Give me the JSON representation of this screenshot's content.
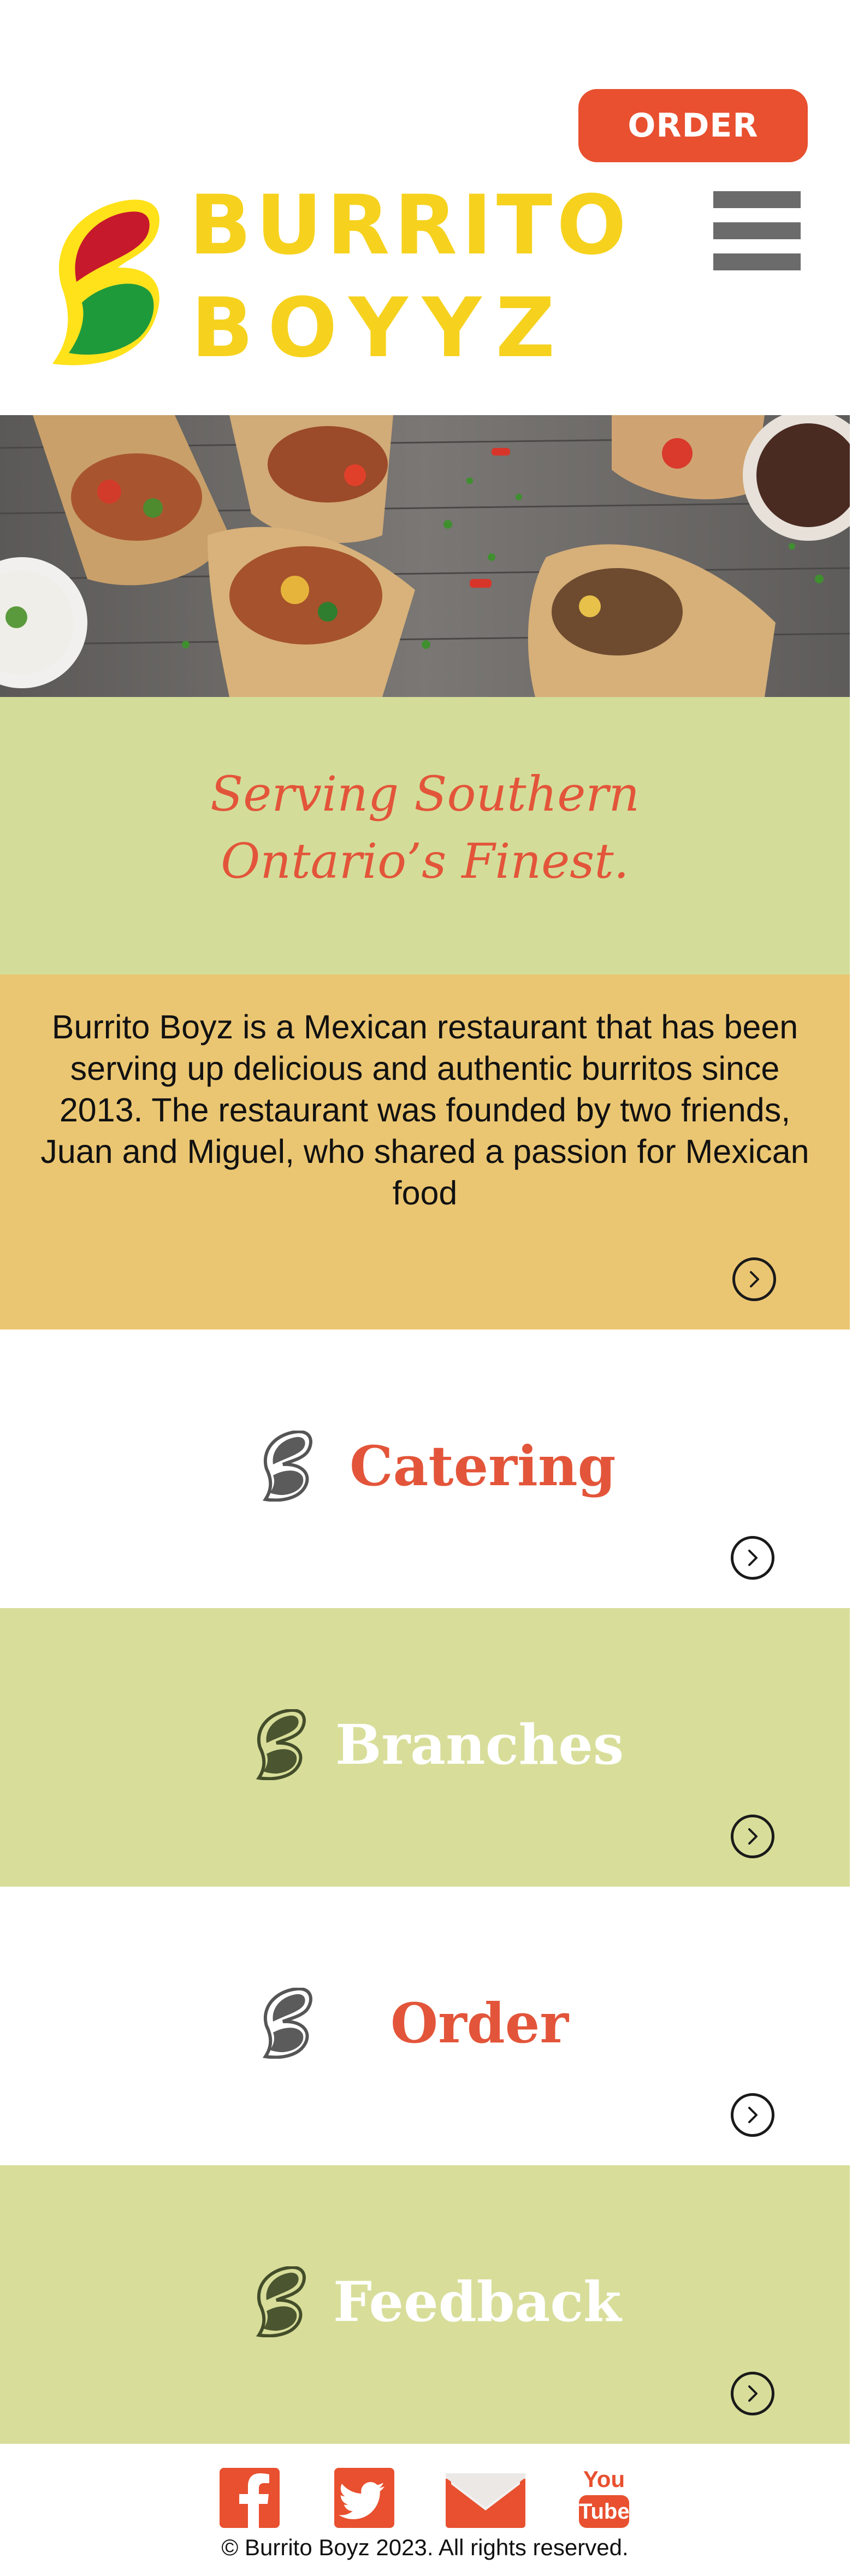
{
  "header": {
    "order_label": "ORDER",
    "brand_line1": "BURRITO",
    "brand_line2": "BOYYZ",
    "menu_icon": "hamburger-menu-icon"
  },
  "hero": {
    "image": "burritos-photo"
  },
  "tagline": {
    "text": "Serving Southern\nOntario’s Finest."
  },
  "about": {
    "text": "Burrito Boyz is a Mexican restaurant that has been serving up delicious and authentic burritos since 2013. The restaurant was founded by two friends, Juan and Miguel, who shared a passion for Mexican food"
  },
  "sections": [
    {
      "label": "Catering",
      "theme": "white",
      "label_color": "#e3553a"
    },
    {
      "label": "Branches",
      "theme": "green",
      "label_color": "#ffffff"
    },
    {
      "label": "Order",
      "theme": "white",
      "label_color": "#e3553a"
    },
    {
      "label": "Feedback",
      "theme": "green",
      "label_color": "#ffffff"
    }
  ],
  "footer": {
    "social": [
      "facebook-icon",
      "twitter-icon",
      "mail-icon",
      "youtube-icon"
    ],
    "youtube_top": "You",
    "youtube_bottom": "Tube",
    "copyright": "© Burrito Boyz 2023. All rights reserved."
  },
  "colors": {
    "accent": "#e8502f",
    "brand_yellow": "#f6d21e",
    "green_band": "#d3dd99",
    "about_band": "#ebc672"
  }
}
